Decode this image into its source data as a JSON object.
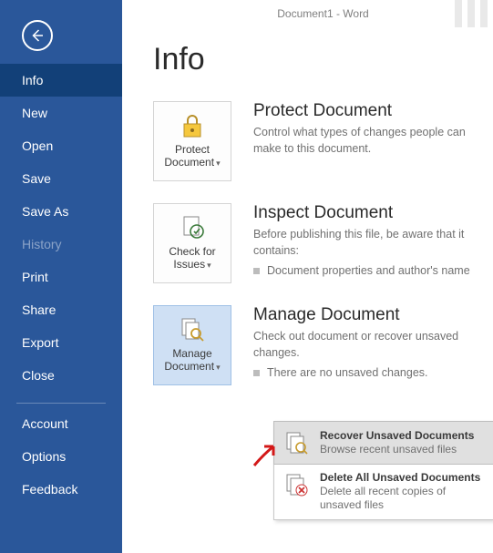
{
  "titlebar": "Document1 - Word",
  "page_title": "Info",
  "sidebar": {
    "items": [
      {
        "label": "Info",
        "selected": true,
        "disabled": false
      },
      {
        "label": "New",
        "selected": false,
        "disabled": false
      },
      {
        "label": "Open",
        "selected": false,
        "disabled": false
      },
      {
        "label": "Save",
        "selected": false,
        "disabled": false
      },
      {
        "label": "Save As",
        "selected": false,
        "disabled": false
      },
      {
        "label": "History",
        "selected": false,
        "disabled": true
      },
      {
        "label": "Print",
        "selected": false,
        "disabled": false
      },
      {
        "label": "Share",
        "selected": false,
        "disabled": false
      },
      {
        "label": "Export",
        "selected": false,
        "disabled": false
      },
      {
        "label": "Close",
        "selected": false,
        "disabled": false
      }
    ],
    "footer": [
      {
        "label": "Account"
      },
      {
        "label": "Options"
      },
      {
        "label": "Feedback"
      }
    ]
  },
  "sections": {
    "protect": {
      "button": "Protect Document",
      "title": "Protect Document",
      "desc": "Control what types of changes people can make to this document."
    },
    "inspect": {
      "button": "Check for Issues",
      "title": "Inspect Document",
      "desc": "Before publishing this file, be aware that it contains:",
      "bullet": "Document properties and author's name"
    },
    "manage": {
      "button": "Manage Document",
      "title": "Manage Document",
      "desc": "Check out document or recover unsaved changes.",
      "bullet": "There are no unsaved changes."
    }
  },
  "menu": {
    "recover": {
      "title": "Recover Unsaved Documents",
      "sub": "Browse recent unsaved files"
    },
    "delete": {
      "title": "Delete All Unsaved Documents",
      "sub": "Delete all recent copies of unsaved files"
    }
  }
}
